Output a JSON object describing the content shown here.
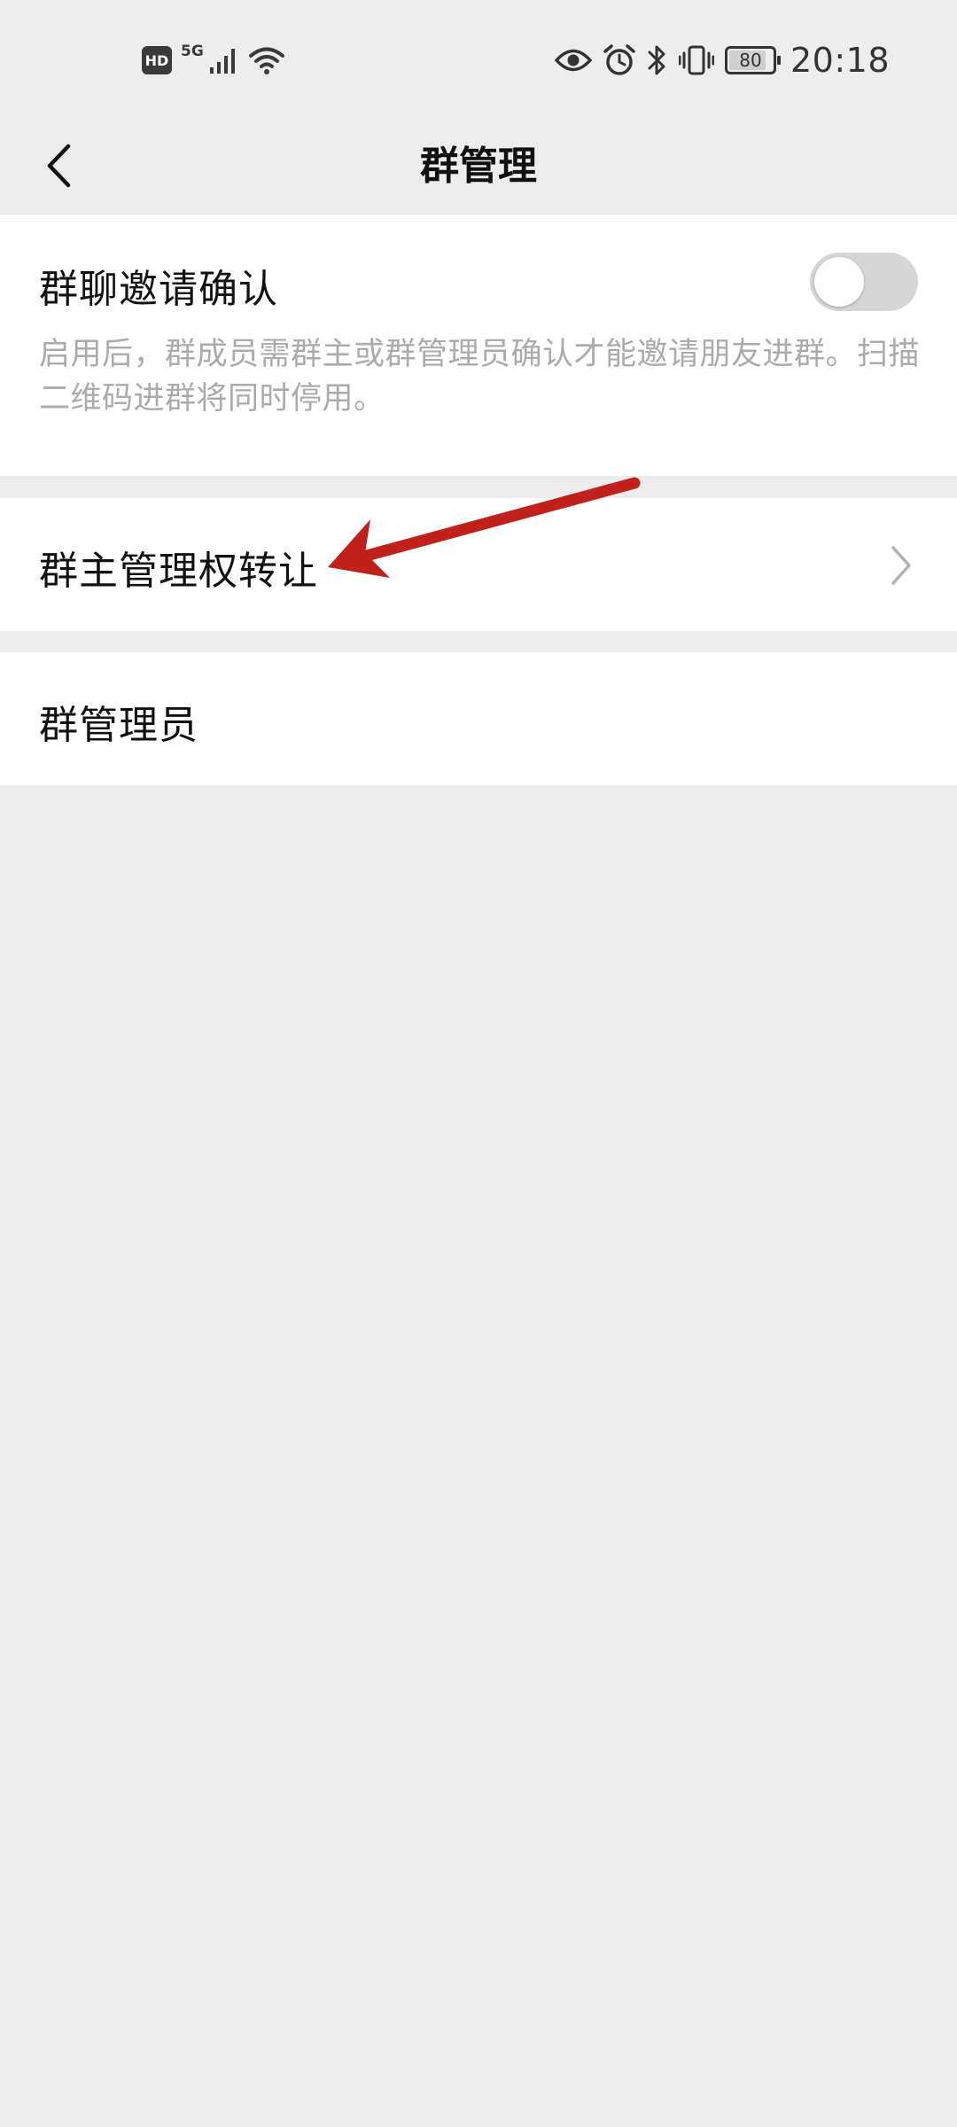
{
  "status_bar": {
    "hd": "HD",
    "network": "5G",
    "battery": "80",
    "time": "20:18",
    "icons": [
      "hd-icon",
      "signal-icon",
      "wifi-icon",
      "eye-icon",
      "alarm-icon",
      "bluetooth-icon",
      "vibrate-icon",
      "battery-icon"
    ]
  },
  "nav": {
    "title": "群管理",
    "back_icon": "chevron-left-icon"
  },
  "settings": {
    "invite_confirm": {
      "label": "群聊邀请确认",
      "description": "启用后，群成员需群主或群管理员确认才能邀请朋友进群。扫描二维码进群将同时停用。",
      "enabled": false
    },
    "transfer_owner": {
      "label": "群主管理权转让",
      "icon": "chevron-right-icon"
    },
    "admins": {
      "label": "群管理员"
    }
  },
  "annotation": {
    "type": "arrow",
    "color": "#c0221b"
  },
  "colors": {
    "background": "#ededed",
    "card": "#ffffff",
    "primary_text": "#111111",
    "secondary_text": "#ababab",
    "toggle_off": "#d6d6d6"
  }
}
